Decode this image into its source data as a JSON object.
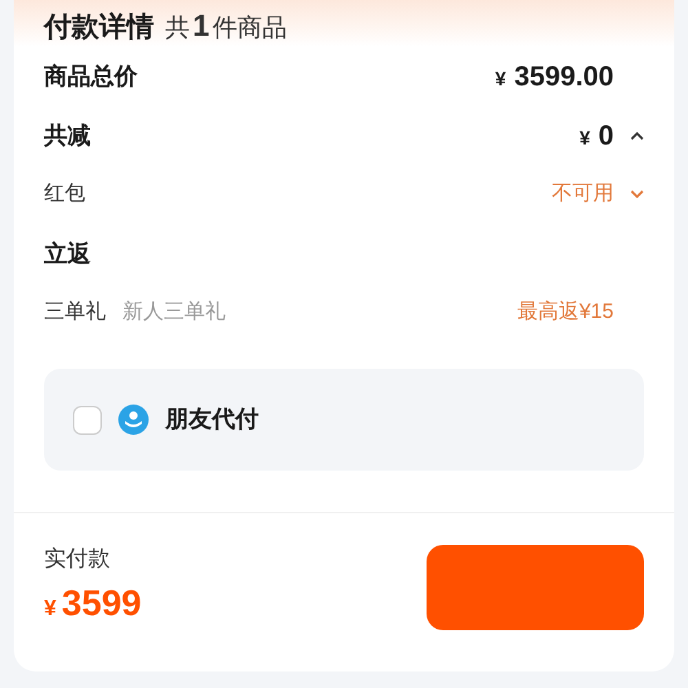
{
  "header": {
    "title": "付款详情",
    "count_prefix": "共",
    "count": "1",
    "count_suffix": "件商品"
  },
  "rows": [
    {
      "kind": "main",
      "label": "商品总价",
      "currency": "¥",
      "value": "3599.00"
    },
    {
      "kind": "main",
      "label": "共减",
      "currency": "¥",
      "value": "0",
      "expanded": true
    },
    {
      "kind": "sub",
      "label": "红包",
      "value": "不可用",
      "expanded": false
    },
    {
      "kind": "heading",
      "label": "立返"
    },
    {
      "kind": "sub",
      "label": "三单礼",
      "note": "新人三单礼",
      "value": "最高返¥15"
    }
  ],
  "friend_pay": {
    "label": "朋友代付",
    "checked": false
  },
  "footer": {
    "label": "实付款",
    "currency": "¥",
    "amount": "3599"
  }
}
